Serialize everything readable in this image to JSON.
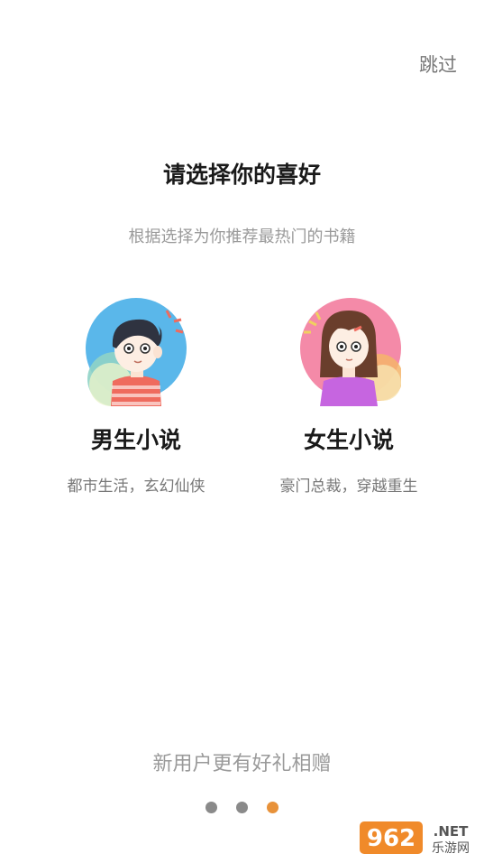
{
  "header": {
    "skip_label": "跳过"
  },
  "intro": {
    "title": "请选择你的喜好",
    "subtitle": "根据选择为你推荐最热门的书籍"
  },
  "options": [
    {
      "label": "男生小说",
      "description": "都市生活，玄幻仙侠",
      "icon": "boy-avatar-icon"
    },
    {
      "label": "女生小说",
      "description": "豪门总裁，穿越重生",
      "icon": "girl-avatar-icon"
    }
  ],
  "footer": {
    "promo_text": "新用户更有好礼相赠",
    "pager": {
      "total": 3,
      "active_index": 2
    }
  },
  "watermark": {
    "text_top": "962.NET",
    "text_bottom": "乐游网"
  },
  "colors": {
    "accent": "#e8923a",
    "inactive_dot": "#8a8a8a"
  }
}
